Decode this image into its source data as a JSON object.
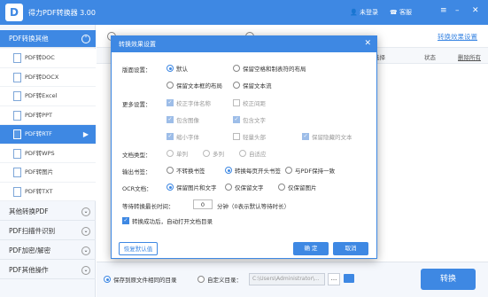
{
  "app": {
    "title": "得力PDF转换器 3.00",
    "login": "未登录",
    "service": "客服",
    "logo_letter": "D"
  },
  "sidebar": {
    "categories": [
      {
        "label": "PDF转换其他"
      },
      {
        "label": "其他转换PDF"
      },
      {
        "label": "PDF扫描件识别"
      },
      {
        "label": "PDF加密/解密"
      },
      {
        "label": "PDF其他操作"
      }
    ],
    "items": [
      {
        "label": "PDF转DOC"
      },
      {
        "label": "PDF转DOCX"
      },
      {
        "label": "PDF转Excel"
      },
      {
        "label": "PDF转PPT"
      },
      {
        "label": "PDF转RTF"
      },
      {
        "label": "PDF转WPS"
      },
      {
        "label": "PDF转图片"
      },
      {
        "label": "PDF转TXT"
      }
    ]
  },
  "main": {
    "effect_link": "转换效果设置",
    "columns": [
      "页面选择",
      "状态",
      "删除所有"
    ]
  },
  "bottom": {
    "same_dir_label": "保存到原文件相同的目录",
    "custom_dir_label": "自定义目录：",
    "path_value": "C:\\Users\\Administrator\\...",
    "browse_label": "...",
    "convert_label": "转换"
  },
  "dialog": {
    "title": "转换效果设置",
    "layout": {
      "label": "版面设置：",
      "opt_default": "默认",
      "opt_keep_space": "保留空格和制表符的布局",
      "opt_keep_text_layout": "保留文本框的布局",
      "opt_keep_text_flow": "保留文本流"
    },
    "more": {
      "label": "更多设置：",
      "opt_correct_font": "校正字体名称",
      "opt_correct_paragraph": "校正间距",
      "opt_include_images": "包含图像",
      "opt_include_text": "包含文字",
      "opt_small_caps": "缩小字体",
      "opt_light_header": "轻量头部",
      "opt_keep_hidden": "保留隐藏的文本"
    },
    "doc_type": {
      "label": "文档类型：",
      "opt_single": "单列",
      "opt_multi": "多列",
      "opt_auto": "自适应"
    },
    "bookmark": {
      "label": "输出书签：",
      "opt_none": "不转换书签",
      "opt_start": "转换每页开头书签",
      "opt_same": "与PDF保持一致"
    },
    "ocr": {
      "label": "OCR文档：",
      "opt_img_text": "保留图片和文字",
      "opt_text_only": "仅保留文字",
      "opt_img_only": "仅保留图片"
    },
    "timeout": {
      "label": "等待转换最长时间：",
      "value": "0",
      "unit": "分钟（0表示默认等待时长）"
    },
    "open_dir_label": "转换成功后，自动打开文档目录",
    "restore_label": "恢复默认值",
    "ok_label": "确 定",
    "cancel_label": "取消"
  },
  "colors": {
    "accent": "#3e88e3",
    "background": "#ffffff",
    "sidebar_bg": "#f4f7fc"
  }
}
